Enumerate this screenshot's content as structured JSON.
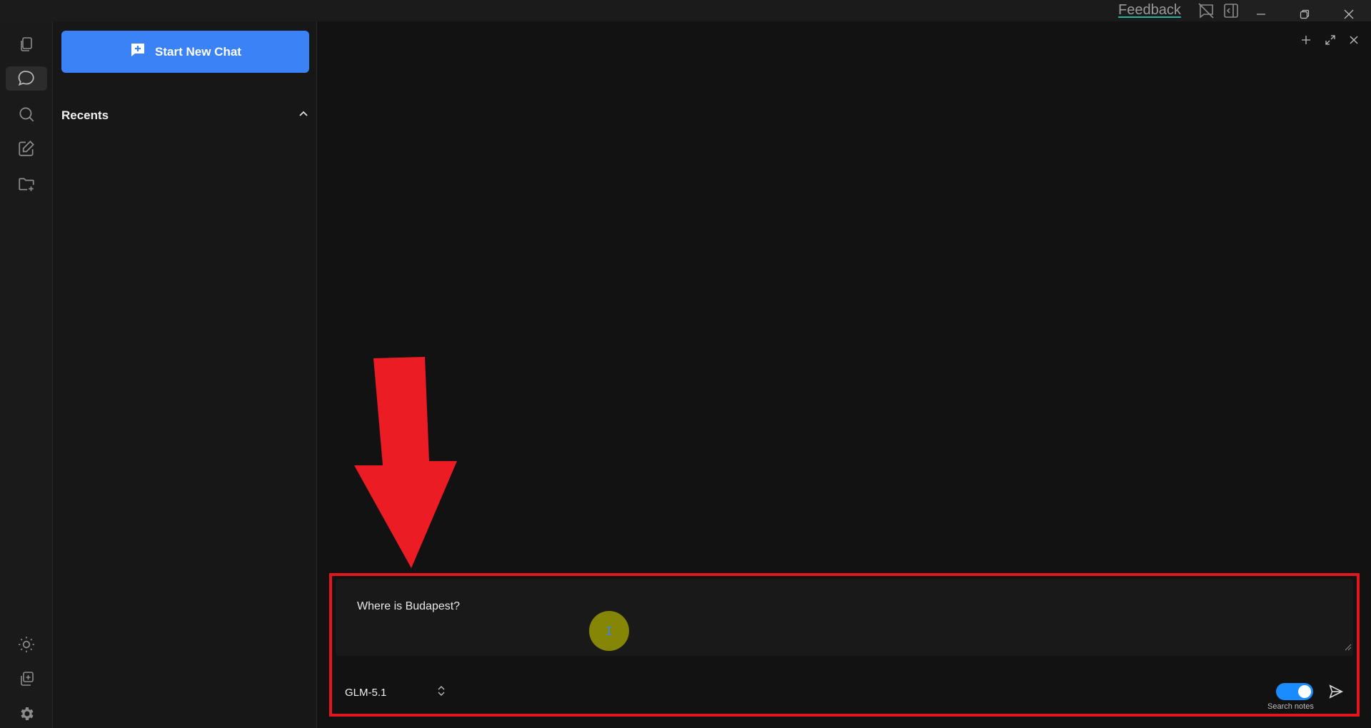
{
  "titlebar": {
    "feedback_label": "Feedback"
  },
  "sidebar": {
    "new_chat_label": "Start New Chat",
    "recents_label": "Recents"
  },
  "composer": {
    "input_value": "Where is Budapest?",
    "cursor_glyph": "I",
    "model_name": "GLM-5.1",
    "search_notes_label": "Search notes",
    "search_notes_enabled": true
  },
  "colors": {
    "accent": "#3b82f6",
    "toggle": "#1a8cff",
    "annotation": "#e3161f",
    "background": "#121212"
  }
}
